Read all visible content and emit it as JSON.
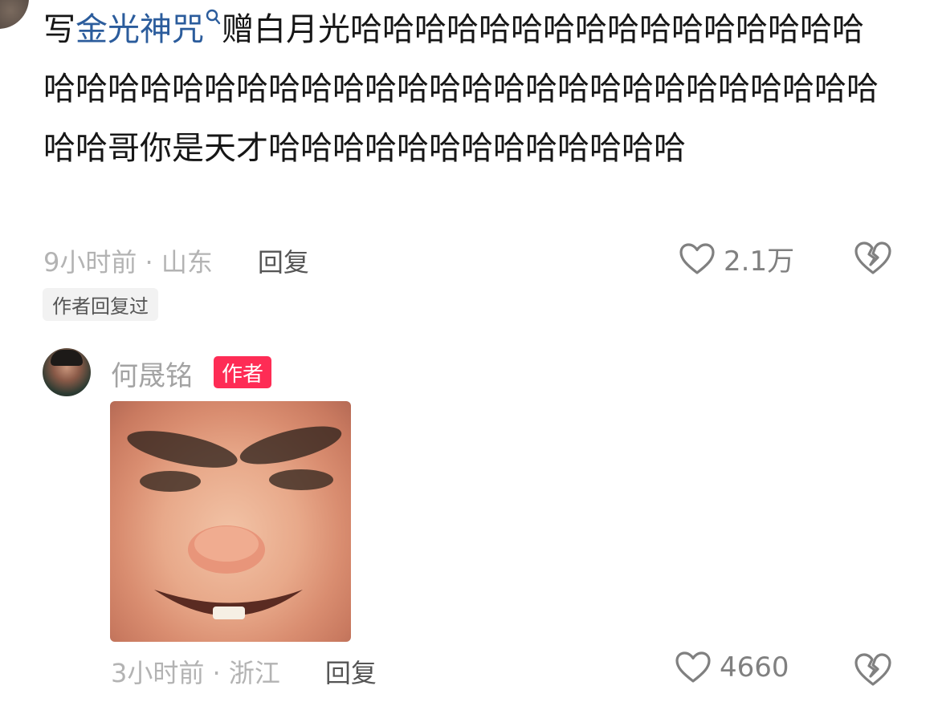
{
  "comment": {
    "prefix": "写",
    "link_text": "金光神咒",
    "body": "赠白月光哈哈哈哈哈哈哈哈哈哈哈哈哈哈哈哈哈哈哈哈哈哈哈哈哈哈哈哈哈哈哈哈哈哈哈哈哈哈哈哈哈哈哈哈哥你是天才哈哈哈哈哈哈哈哈哈哈哈哈哈",
    "time_location": "9小时前 · 山东",
    "reply_label": "回复",
    "like_count": "2.1万",
    "author_replied_tag": "作者回复过"
  },
  "reply": {
    "username": "何晟铭",
    "author_badge": "作者",
    "time_location": "3小时前 · 浙江",
    "reply_label": "回复",
    "like_count": "4660"
  },
  "icons": {
    "like": "heart-outline-icon",
    "dislike": "broken-heart-icon",
    "search": "search-icon"
  },
  "colors": {
    "link": "#2b5c9c",
    "badge": "#fe2c55",
    "meta": "#b3b3b3"
  }
}
